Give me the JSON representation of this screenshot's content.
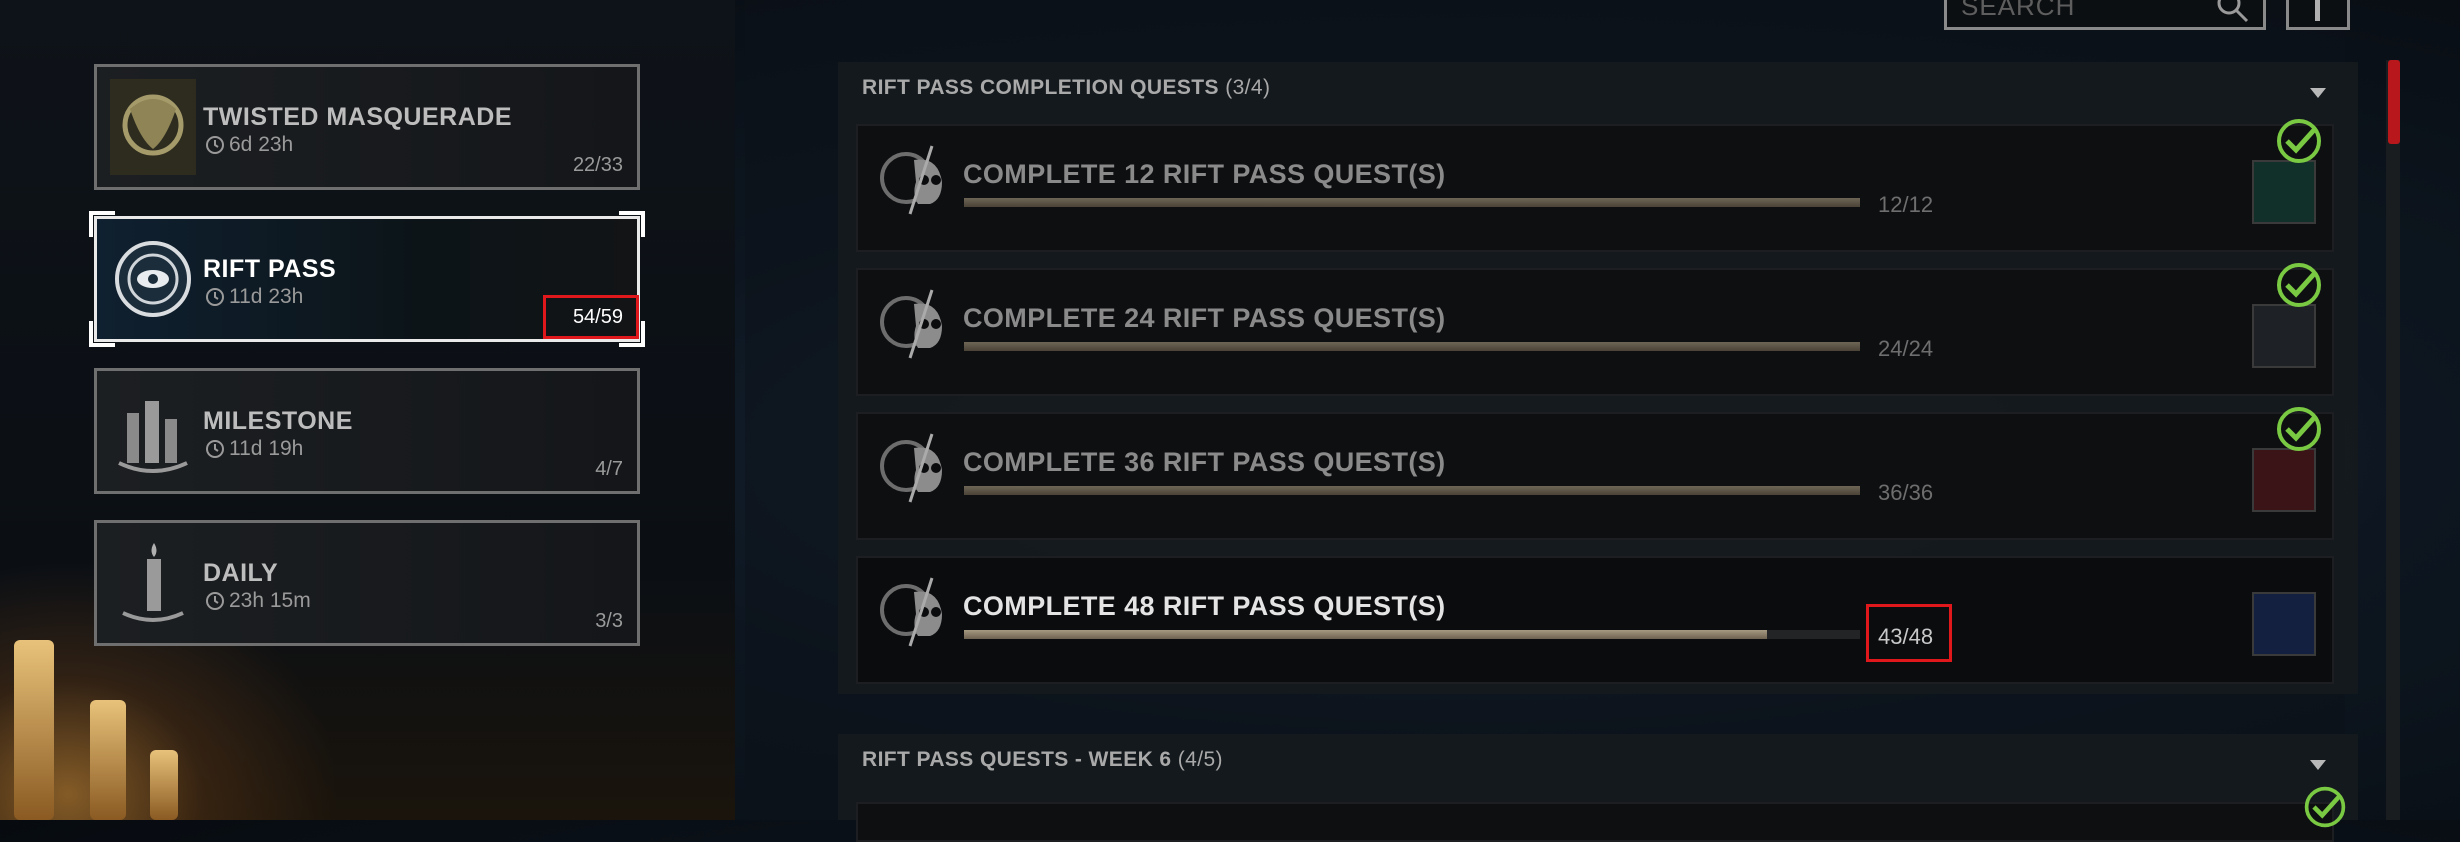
{
  "search": {
    "placeholder": "SEARCH"
  },
  "categories": [
    {
      "title": "TWISTED MASQUERADE",
      "timer": "6d 23h",
      "count": "22/33",
      "icon": "masquerade-emblem-icon"
    },
    {
      "title": "RIFT PASS",
      "timer": "11d 23h",
      "count": "54/59",
      "icon": "rift-eye-icon"
    },
    {
      "title": "MILESTONE",
      "timer": "11d 19h",
      "count": "4/7",
      "icon": "candles-icon"
    },
    {
      "title": "DAILY",
      "timer": "23h 15m",
      "count": "3/3",
      "icon": "single-candle-icon"
    }
  ],
  "sections": [
    {
      "title": "RIFT PASS COMPLETION QUESTS",
      "count": "(3/4)",
      "quests": [
        {
          "title": "COMPLETE 12 RIFT PASS QUEST(S)",
          "count": "12/12",
          "progress": 1.0,
          "completed": true
        },
        {
          "title": "COMPLETE 24 RIFT PASS QUEST(S)",
          "count": "24/24",
          "progress": 1.0,
          "completed": true
        },
        {
          "title": "COMPLETE 36 RIFT PASS QUEST(S)",
          "count": "36/36",
          "progress": 1.0,
          "completed": true
        },
        {
          "title": "COMPLETE 48 RIFT PASS QUEST(S)",
          "count": "43/48",
          "progress": 0.896,
          "completed": false
        }
      ]
    },
    {
      "title": "RIFT PASS QUESTS - WEEK 6",
      "count": "(4/5)"
    }
  ],
  "colors": {
    "accent_red": "#e0181c",
    "check_green": "#7ac943"
  }
}
